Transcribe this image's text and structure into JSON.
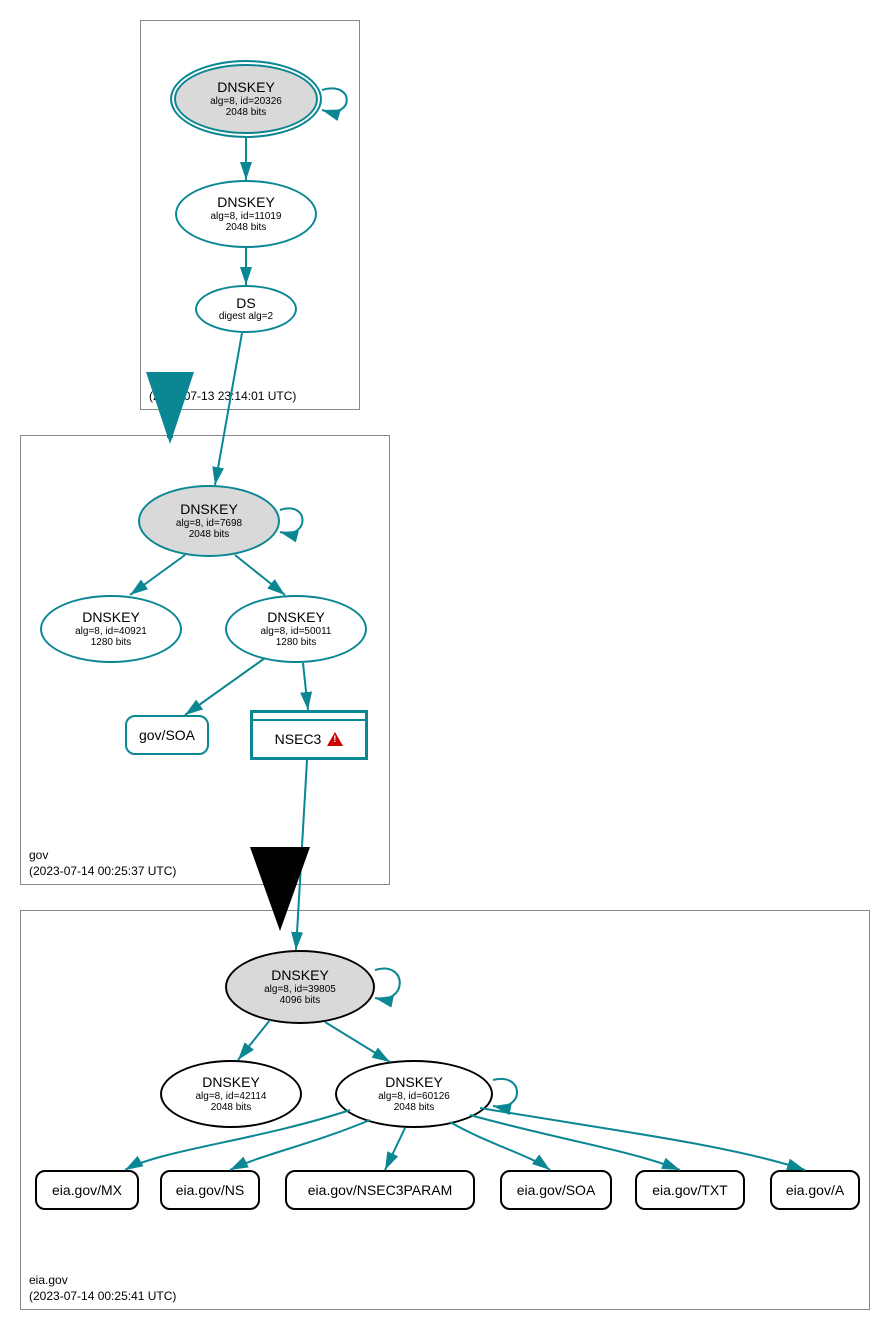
{
  "zones": {
    "root": {
      "label": ".",
      "timestamp": "(2023-07-13 23:14:01 UTC)"
    },
    "gov": {
      "label": "gov",
      "timestamp": "(2023-07-14 00:25:37 UTC)"
    },
    "eia": {
      "label": "eia.gov",
      "timestamp": "(2023-07-14 00:25:41 UTC)"
    }
  },
  "nodes": {
    "root_ksk": {
      "title": "DNSKEY",
      "line2": "alg=8, id=20326",
      "line3": "2048 bits"
    },
    "root_zsk": {
      "title": "DNSKEY",
      "line2": "alg=8, id=11019",
      "line3": "2048 bits"
    },
    "root_ds": {
      "title": "DS",
      "line2": "digest alg=2"
    },
    "gov_ksk": {
      "title": "DNSKEY",
      "line2": "alg=8, id=7698",
      "line3": "2048 bits"
    },
    "gov_zsk1": {
      "title": "DNSKEY",
      "line2": "alg=8, id=40921",
      "line3": "1280 bits"
    },
    "gov_zsk2": {
      "title": "DNSKEY",
      "line2": "alg=8, id=50011",
      "line3": "1280 bits"
    },
    "gov_soa": {
      "title": "gov/SOA"
    },
    "gov_nsec3": {
      "title": "NSEC3"
    },
    "eia_ksk": {
      "title": "DNSKEY",
      "line2": "alg=8, id=39805",
      "line3": "4096 bits"
    },
    "eia_zsk1": {
      "title": "DNSKEY",
      "line2": "alg=8, id=42114",
      "line3": "2048 bits"
    },
    "eia_zsk2": {
      "title": "DNSKEY",
      "line2": "alg=8, id=60126",
      "line3": "2048 bits"
    },
    "eia_mx": {
      "title": "eia.gov/MX"
    },
    "eia_ns": {
      "title": "eia.gov/NS"
    },
    "eia_n3p": {
      "title": "eia.gov/NSEC3PARAM"
    },
    "eia_soa": {
      "title": "eia.gov/SOA"
    },
    "eia_txt": {
      "title": "eia.gov/TXT"
    },
    "eia_a": {
      "title": "eia.gov/A"
    }
  },
  "colors": {
    "teal": "#0b8794",
    "black": "#000000"
  }
}
